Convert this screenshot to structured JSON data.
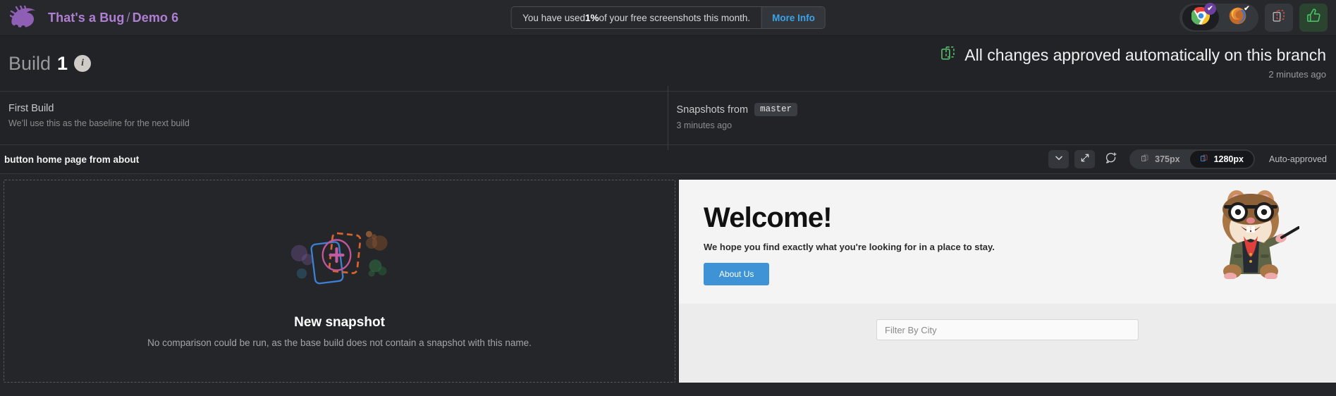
{
  "topbar": {
    "brand_org": "That's a Bug",
    "brand_sep": "/",
    "brand_project": "Demo 6",
    "logo_icon": "hedgehog-logo-icon",
    "usage_prefix": "You have used ",
    "usage_percent": "1%",
    "usage_suffix": " of your free screenshots this month.",
    "more_info_label": "More Info",
    "browsers": [
      {
        "name": "chrome-browser-icon",
        "badge": "checkmark",
        "active": true
      },
      {
        "name": "firefox-browser-icon",
        "badge": "checkmark",
        "active": false
      }
    ],
    "tiles": [
      {
        "name": "snapshot-diff-icon"
      },
      {
        "name": "thumbs-up-icon"
      }
    ]
  },
  "build": {
    "label": "Build",
    "number": "1",
    "info_badge": "i",
    "approved_text": "All changes approved automatically on this branch",
    "approved_time": "2 minutes ago",
    "approved_icon": "snapshot-approved-icon"
  },
  "info_strip": [
    {
      "title": "First Build",
      "subtitle": "We’ll use this as the baseline for the next build"
    },
    {
      "title": "Snapshots from",
      "branch": "master",
      "subtitle": "3 minutes ago"
    }
  ],
  "snapshot_toolbar": {
    "name": "button home page from about",
    "buttons": [
      {
        "name": "chevron-down-icon"
      },
      {
        "name": "expand-arrows-icon"
      },
      {
        "name": "add-comment-icon"
      }
    ],
    "widths": [
      {
        "label": "375px",
        "active": false,
        "icon": "snapshot-width-icon"
      },
      {
        "label": "1280px",
        "active": true,
        "icon": "snapshot-width-active-icon"
      }
    ],
    "status": "Auto-approved"
  },
  "compare": {
    "new_snapshot_title": "New snapshot",
    "new_snapshot_desc": "No comparison could be run, as the base build does not contain a snapshot with this name.",
    "illustration": "new-snapshot-illustration"
  },
  "preview": {
    "hero_title": "Welcome!",
    "hero_subtitle": "We hope you find exactly what you're looking for in a place to stay.",
    "hero_button": "About Us",
    "mascot": "hamster-mascot-icon",
    "filter_placeholder": "Filter By City"
  },
  "colors": {
    "brand_purple": "#b07fd4",
    "link_blue": "#3ba3e8",
    "approved_green": "#56b96a",
    "active_pill": "#15171a",
    "page_bg": "#24262a",
    "hero_button_blue": "#3d93d6"
  }
}
